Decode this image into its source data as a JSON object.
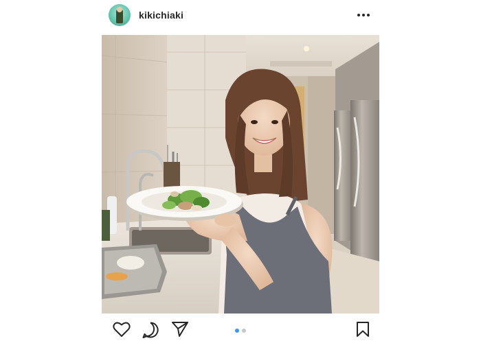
{
  "post": {
    "username": "kikichiaki"
  },
  "carousel": {
    "count": 2,
    "active_index": 0,
    "active_color": "#3897f0",
    "inactive_color": "#c7c7c7"
  },
  "icons": {
    "more": "more-options-icon",
    "like": "heart-icon",
    "comment": "comment-icon",
    "share": "send-icon",
    "save": "bookmark-icon"
  }
}
